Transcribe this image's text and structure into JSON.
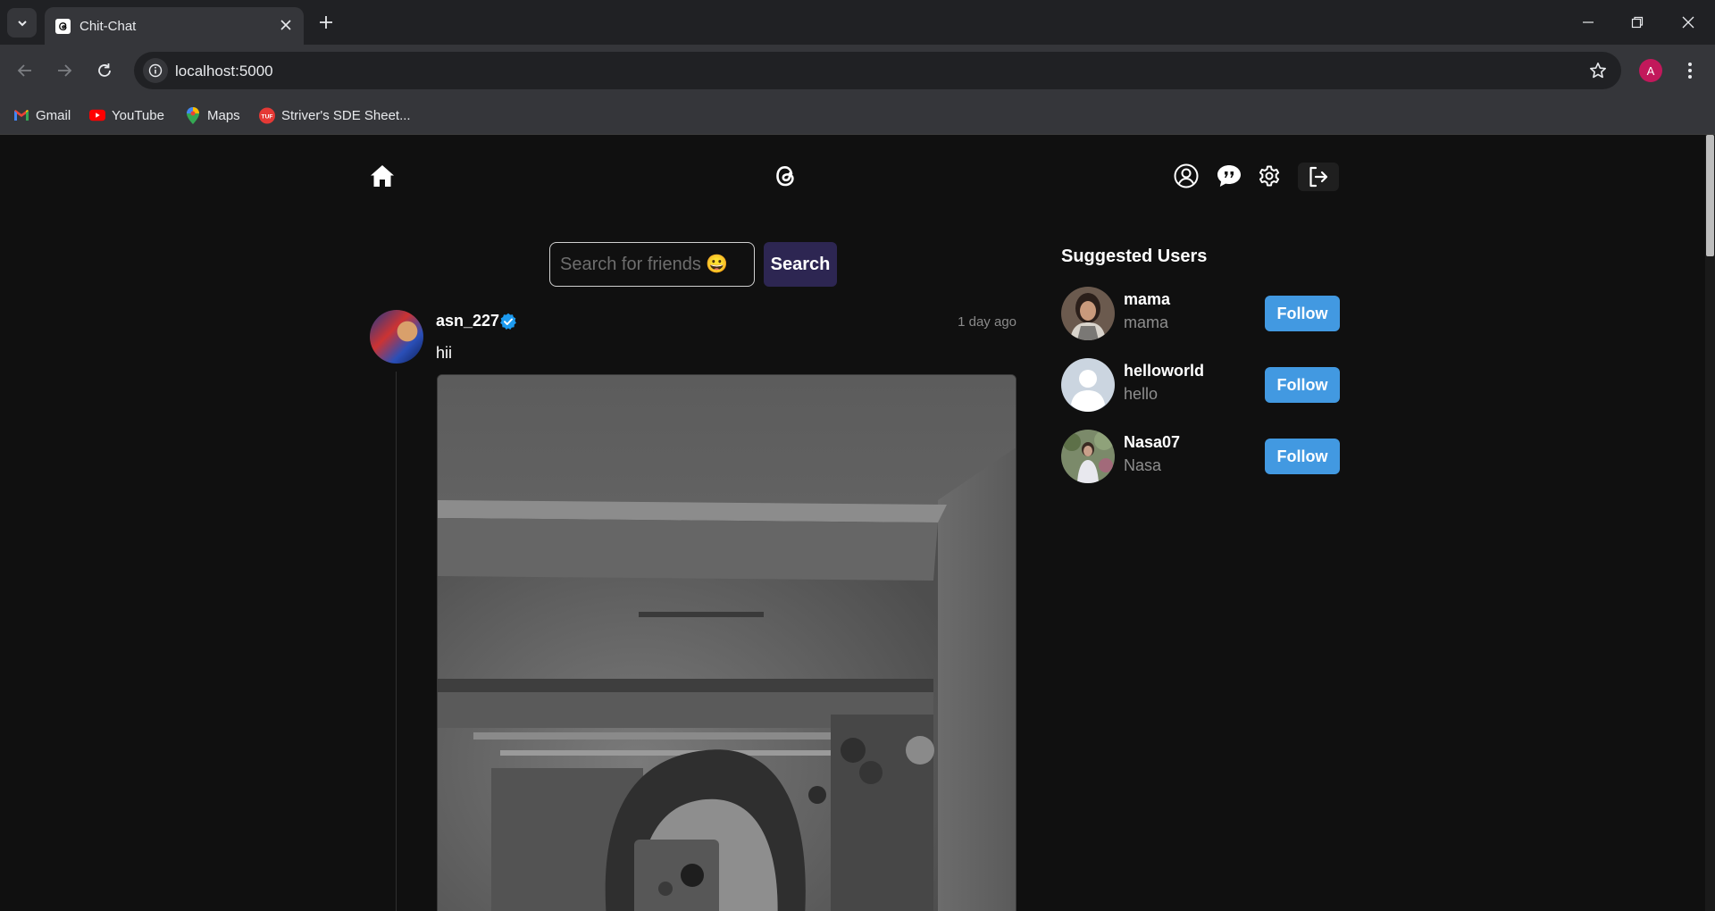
{
  "browser": {
    "tab_title": "Chit-Chat",
    "url": "localhost:5000",
    "profile_initial": "A",
    "bookmarks": [
      {
        "label": "Gmail",
        "icon": "gmail-icon"
      },
      {
        "label": "YouTube",
        "icon": "youtube-icon"
      },
      {
        "label": "Maps",
        "icon": "maps-icon"
      },
      {
        "label": "Striver's SDE Sheet...",
        "icon": "tuf-icon"
      }
    ]
  },
  "header": {
    "icons": [
      "home-icon",
      "threads-logo-icon",
      "profile-icon",
      "chat-icon",
      "settings-icon",
      "logout-icon"
    ]
  },
  "search": {
    "placeholder": "Search for friends 😀",
    "button_label": "Search"
  },
  "post": {
    "username": "asn_227",
    "verified": true,
    "time": "1 day ago",
    "text": "hii"
  },
  "suggested": {
    "title": "Suggested Users",
    "users": [
      {
        "username": "mama",
        "name": "mama",
        "button": "Follow"
      },
      {
        "username": "helloworld",
        "name": "hello",
        "button": "Follow"
      },
      {
        "username": "Nasa07",
        "name": "Nasa",
        "button": "Follow"
      }
    ]
  },
  "colors": {
    "background": "#101010",
    "follow_button": "#4299e1",
    "search_button": "#2d2652",
    "verified_badge": "#1d9bf0"
  }
}
